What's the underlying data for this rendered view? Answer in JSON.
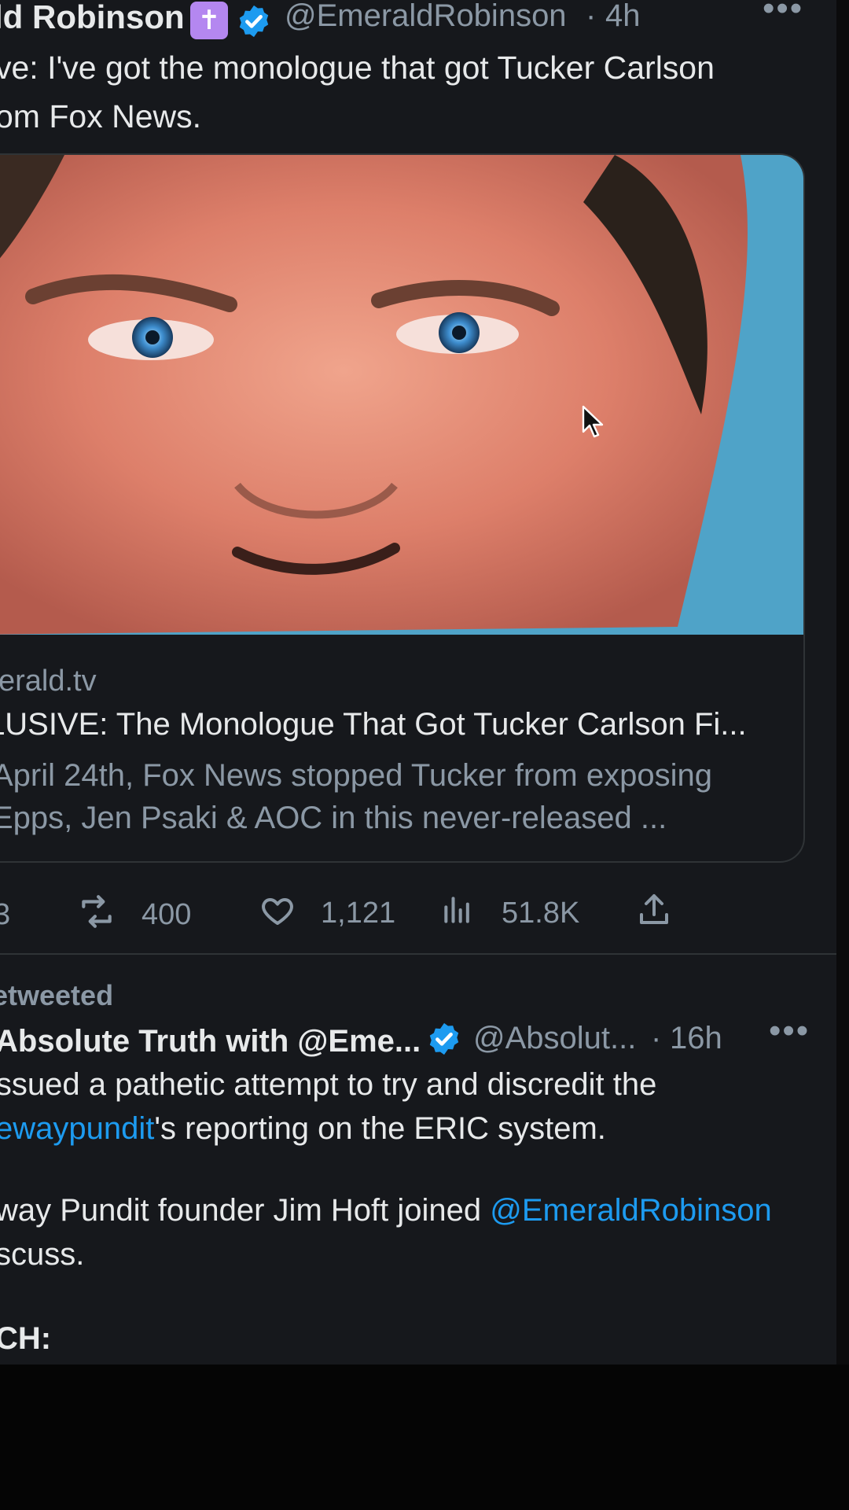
{
  "tweet1": {
    "author_name": "ld Robinson",
    "handle": "@EmeraldRobinson",
    "separator": "·",
    "time": "4h",
    "text": "ve: I've got the monologue that got Tucker Carlson om Fox News.",
    "text_line1": "ve: I've got the monologue that got Tucker Carlson",
    "text_line2": "om Fox News.",
    "card": {
      "domain": "erald.tv",
      "title": "LUSIVE: The Monologue That Got Tucker Carlson Fi...",
      "description_line1": "April 24th, Fox News stopped Tucker from exposing",
      "description_line2": "Epps, Jen Psaki & AOC in this never-released ..."
    },
    "actions": {
      "replies": "3",
      "retweets": "400",
      "likes": "1,121",
      "views": "51.8K"
    }
  },
  "tweet2": {
    "retweet_label": "etweeted",
    "author_name": "Absolute Truth with @Eme...",
    "handle": "@Absolut...",
    "separator": "·",
    "time": "16h",
    "line1": "issued a pathetic attempt to try and discredit the",
    "line2_mention": "ewaypundit",
    "line2_rest": "'s reporting on the ERIC system.",
    "line3_text": "way Pundit founder Jim Hoft joined ",
    "line3_mention": "@EmeraldRobinson",
    "line4": "scuss.",
    "line5": "CH:"
  },
  "colors": {
    "background": "#16181c",
    "text": "#e7e9ea",
    "secondary": "#8b98a5",
    "link": "#1d9bf0",
    "verified": "#1d9bf0",
    "badge": "#b487f0"
  },
  "icons": [
    "cross-badge-icon",
    "verified-icon",
    "more-icon",
    "retweet-icon",
    "like-icon",
    "views-icon",
    "share-icon",
    "cursor-icon"
  ]
}
